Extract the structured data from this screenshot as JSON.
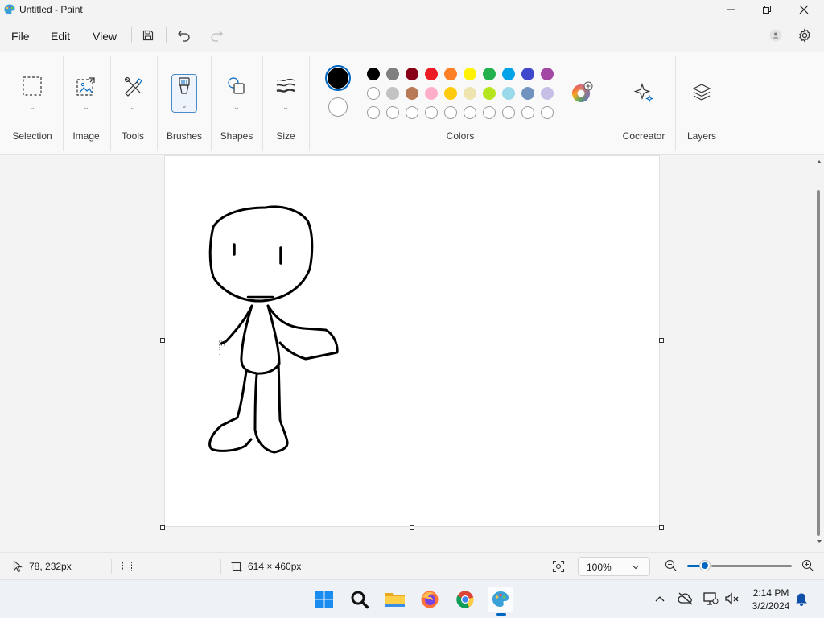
{
  "window": {
    "title": "Untitled - Paint",
    "minimize": "—",
    "maximize": "❐",
    "close": "✕"
  },
  "menu": {
    "items": [
      "File",
      "Edit",
      "View"
    ]
  },
  "ribbon": {
    "groups": {
      "selection": "Selection",
      "image": "Image",
      "tools": "Tools",
      "brushes": "Brushes",
      "shapes": "Shapes",
      "size": "Size",
      "colors": "Colors",
      "cocreator": "Cocreator",
      "layers": "Layers"
    },
    "primary_color": "#000000",
    "secondary_color": "#ffffff",
    "palette_row1": [
      "#000000",
      "#7f7f7f",
      "#880015",
      "#ed1c24",
      "#ff7f27",
      "#fff200",
      "#22b14c",
      "#00a2e8",
      "#3f48cc",
      "#a349a4"
    ],
    "palette_row2": [
      "#ffffff",
      "#c3c3c3",
      "#b97a57",
      "#ffaec9",
      "#ffc90e",
      "#efe4b0",
      "#b5e61d",
      "#99d9ea",
      "#7092be",
      "#c8bfe7"
    ],
    "palette_row3_count": 10
  },
  "status": {
    "cursor_pos": "78, 232px",
    "canvas_size": "614 × 460px",
    "zoom": "100%"
  },
  "taskbar": {
    "time": "2:14 PM",
    "date": "3/2/2024"
  }
}
